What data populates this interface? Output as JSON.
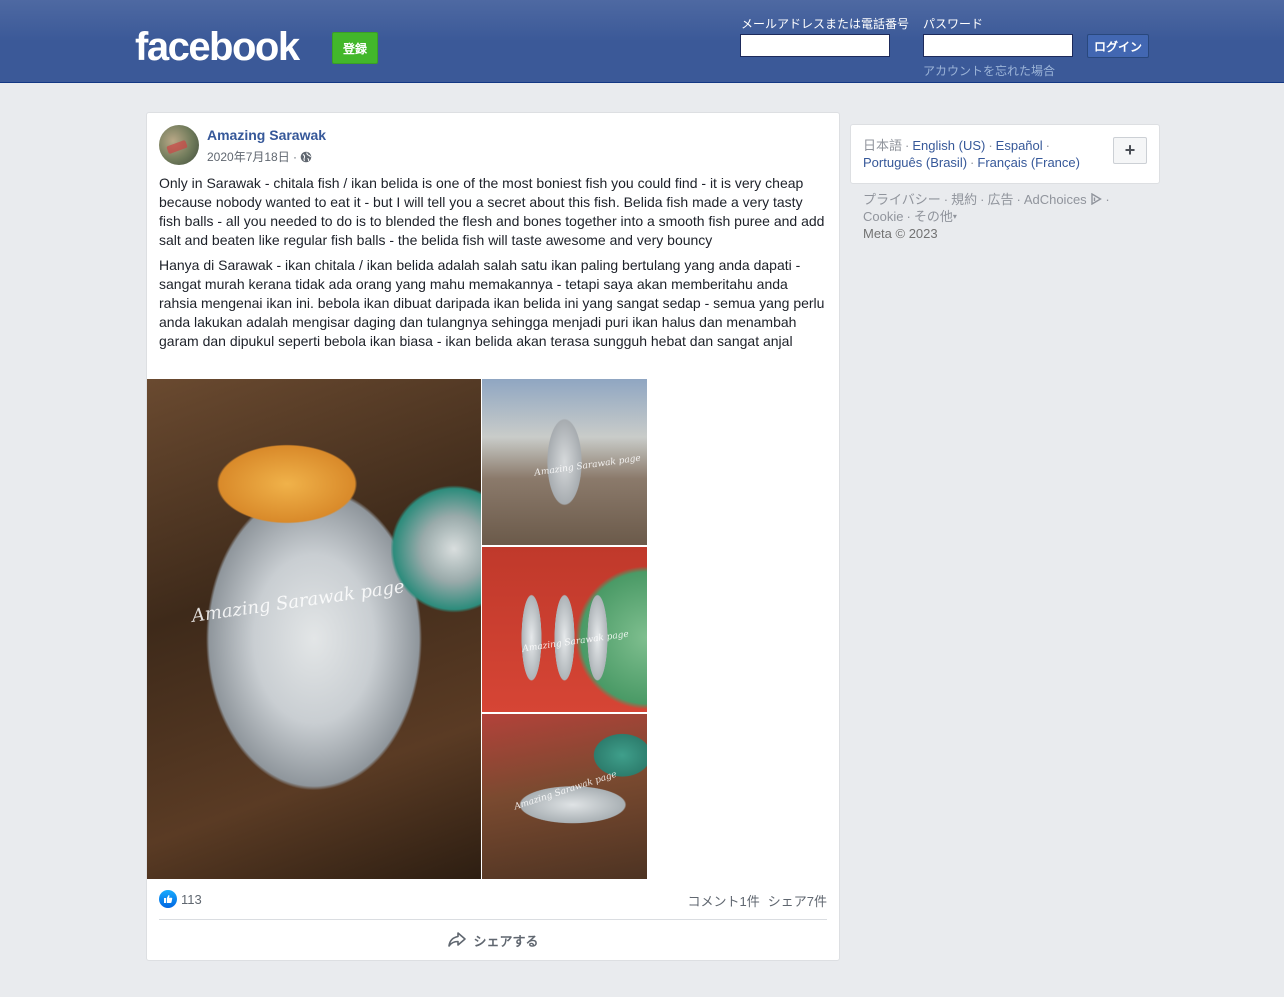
{
  "header": {
    "logo": "facebook",
    "signup_label": "登録",
    "email_label": "メールアドレスまたは電話番号",
    "password_label": "パスワード",
    "login_label": "ログイン",
    "forgot_label": "アカウントを忘れた場合"
  },
  "post": {
    "page_name": "Amazing Sarawak",
    "date": "2020年7月18日 ·",
    "text_en": "Only in Sarawak - chitala fish / ikan belida is one of the most boniest fish you could find - it is very cheap because nobody wanted to eat it - but I will tell you a secret about this fish. Belida fish made a very tasty fish balls - all you needed to do is to blended the flesh and bones together into a smooth fish puree and add salt and beaten like regular fish balls - the belida fish will taste awesome and very bouncy",
    "text_ms": "Hanya di Sarawak - ikan chitala / ikan belida adalah salah satu ikan paling bertulang yang anda dapati - sangat murah kerana tidak ada orang yang mahu memakannya - tetapi saya akan memberitahu anda rahsia mengenai ikan ini. bebola ikan dibuat daripada ikan belida ini yang sangat sedap - semua yang perlu anda lakukan adalah mengisar daging dan tulangnya sehingga menjadi puri ikan halus dan menambah garam dan dipukul seperti bebola ikan biasa - ikan belida akan terasa sungguh hebat dan sangat anjal",
    "photos": [
      {
        "watermark": "Amazing Sarawak page"
      },
      {
        "watermark": "Amazing Sarawak page"
      },
      {
        "watermark": "Amazing Sarawak page"
      },
      {
        "watermark": "Amazing Sarawak page"
      }
    ],
    "like_count": "113",
    "comments": "コメント1件",
    "shares": "シェア7件",
    "share_label": "シェアする"
  },
  "languages": {
    "current": "日本語",
    "items": [
      "English (US)",
      "Español",
      "Português (Brasil)",
      "Français (France)"
    ],
    "more_label": "+"
  },
  "footer": {
    "links": [
      "プライバシー",
      "規約",
      "広告",
      "AdChoices",
      "Cookie",
      "その他"
    ],
    "copyright": "Meta © 2023"
  },
  "colors": {
    "brand_blue": "#3b5998",
    "signup_green": "#42b72a",
    "link_blue": "#365899",
    "background": "#e9ebee"
  }
}
